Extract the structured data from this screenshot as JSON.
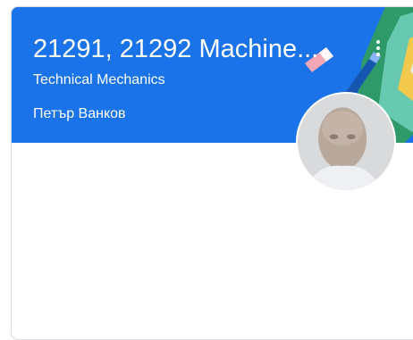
{
  "course_card": {
    "title": "21291, 21292 Machine...",
    "section": "Technical Mechanics",
    "teacher": "Петър Ванков"
  },
  "icons": {
    "more": "more-vert-icon",
    "avatar": "teacher-avatar"
  },
  "colors": {
    "header_bg": "#1a73e8",
    "card_border": "#dadce0"
  }
}
